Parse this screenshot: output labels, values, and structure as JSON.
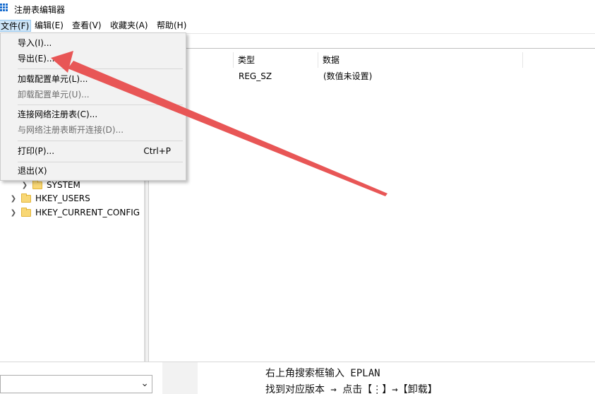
{
  "window": {
    "title": "注册表编辑器"
  },
  "menubar": {
    "file": "文件(F)",
    "edit": "编辑(E)",
    "view": "查看(V)",
    "favorites": "收藏夹(A)",
    "help": "帮助(H)"
  },
  "file_menu": {
    "import": "导入(I)...",
    "export": "导出(E)...",
    "load_hive": "加载配置单元(L)...",
    "unload_hive": "卸载配置单元(U)...",
    "connect_network": "连接网络注册表(C)...",
    "disconnect_network": "与网络注册表断开连接(D)...",
    "print": "打印(P)...",
    "print_shortcut": "Ctrl+P",
    "exit": "退出(X)"
  },
  "tree": {
    "items": [
      {
        "label": "SYSTEM"
      },
      {
        "label": "HKEY_USERS"
      },
      {
        "label": "HKEY_CURRENT_CONFIG"
      }
    ]
  },
  "list": {
    "columns": {
      "type": "类型",
      "data": "数据"
    },
    "rows": [
      {
        "name_fragment": ")",
        "type": "REG_SZ",
        "data": "(数值未设置)"
      }
    ]
  },
  "instructions": {
    "line1": "右上角搜索框输入 EPLAN",
    "line2": "找到对应版本 → 点击【⋮】→【卸载】"
  },
  "colors": {
    "arrow": "#e85656",
    "menu_highlight": "#cce4f7",
    "folder": "#f8d775"
  }
}
